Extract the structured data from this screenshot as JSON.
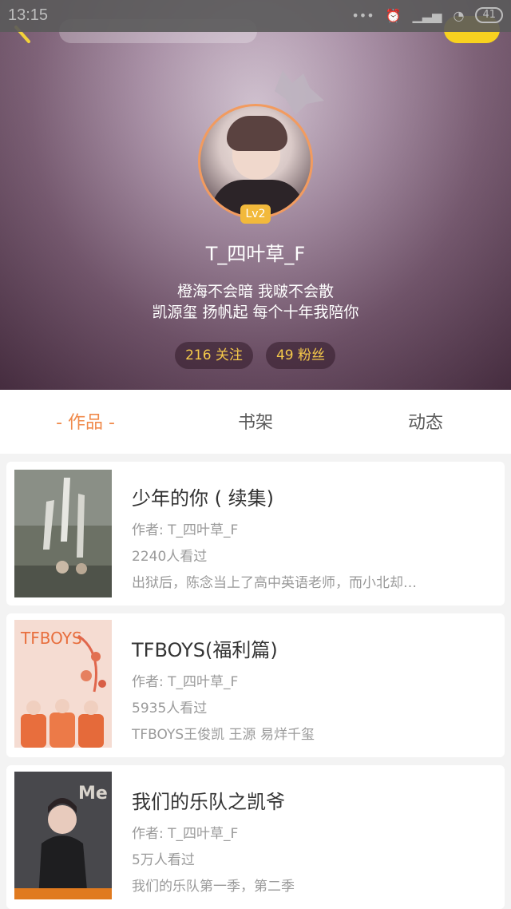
{
  "status_bar": {
    "time": "13:15",
    "battery": "41"
  },
  "profile": {
    "level": "Lv2",
    "username": "T_四叶草_F",
    "bio_line1": "橙海不会暗 我啵不会散",
    "bio_line2": "凯源玺 扬帆起 每个十年我陪你",
    "following": "216 关注",
    "followers": "49 粉丝"
  },
  "tabs": [
    {
      "label": "- 作品 -",
      "active": true
    },
    {
      "label": "书架",
      "active": false
    },
    {
      "label": "动态",
      "active": false
    }
  ],
  "works": [
    {
      "title": "少年的你 ( 续集)",
      "author": "作者: T_四叶草_F",
      "views": "2240人看过",
      "desc": "出狱后，陈念当上了高中英语老师，而小北却…"
    },
    {
      "title": "TFBOYS(福利篇)",
      "author": "作者: T_四叶草_F",
      "views": "5935人看过",
      "desc": "TFBOYS王俊凯 王源 易烊千玺",
      "cover_text": "TFBOYS"
    },
    {
      "title": "我们的乐队之凯爷",
      "author": "作者: T_四叶草_F",
      "views": "5万人看过",
      "desc": "我们的乐队第一季，第二季",
      "cover_text": "Me"
    }
  ],
  "colors": {
    "accent": "#f08a4b",
    "level_badge": "#f2b93b",
    "stat_text": "#f5c94a",
    "action_button": "#f8d21f"
  }
}
